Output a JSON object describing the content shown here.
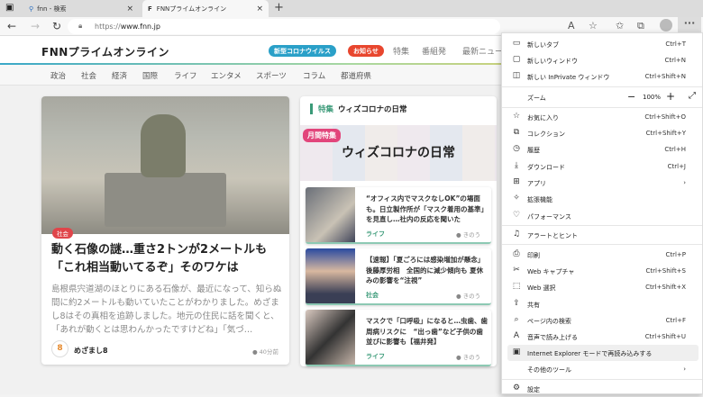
{
  "browser": {
    "tabs": [
      {
        "label": "fnn - 検索",
        "icon": "search-icon"
      },
      {
        "label": "FNNプライムオンライン",
        "icon": "fnn-favicon"
      }
    ],
    "new_tab": "+",
    "url_prefix": "https://",
    "url_domain": "www.fnn.jp"
  },
  "site": {
    "logo": "FNNプライムオンライン",
    "pills": [
      {
        "label": "新型コロナウイルス",
        "color": "#2aa0c8"
      },
      {
        "label": "お知らせ",
        "color": "#e8462e"
      }
    ],
    "header_links": [
      "特集",
      "番組発",
      "最新ニュー"
    ],
    "nav": [
      "政治",
      "社会",
      "経済",
      "国際",
      "ライフ",
      "エンタメ",
      "スポーツ",
      "コラム",
      "都道府県"
    ]
  },
  "main_article": {
    "category": "社会",
    "title": "動く石像の謎…重さ2トンが2メートルも「これ相当動いてるぞ」そのワケは",
    "description": "島根県宍道湖のほとりにある石像が、最近になって、知らぬ間に約2メートルも動いていたことがわかりました。めざまし8はその真相を追跡しました。地元の住民に話を聞くと、「あれが動くとは思わんかったですけどね」「気づ…",
    "source": "めざまし8",
    "source_icon": "8",
    "time": "40分前"
  },
  "feature": {
    "section_label": "特集",
    "section_title": "ウィズコロナの日常",
    "banner_badge": "月間特集",
    "banner_title": "ウィズコロナの日常",
    "items": [
      {
        "title": "“オフィス内でマスクなしOK”の場面も。日立製作所が「マスク着用の基準」を見直し…社内の反応を聞いた",
        "category": "ライフ",
        "time": "きのう"
      },
      {
        "title": "【速報】「夏ごろには感染増加が懸念」後藤厚労相　全国的に減少傾向も 夏休みの影響を“注視”",
        "category": "社会",
        "time": "きのう"
      },
      {
        "title": "マスクで「口呼吸」になると…虫歯、歯周病リスクに　“出っ歯”など子供の歯並びに影響も【福井発】",
        "category": "ライフ",
        "time": "きのう"
      }
    ]
  },
  "menu": {
    "items": [
      {
        "label": "新しいタブ",
        "key": "Ctrl+T",
        "icon": "new-tab-icon"
      },
      {
        "label": "新しいウィンドウ",
        "key": "Ctrl+N",
        "icon": "window-icon"
      },
      {
        "label": "新しい InPrivate ウィンドウ",
        "key": "Ctrl+Shift+N",
        "icon": "inprivate-icon"
      },
      {
        "label": "お気に入り",
        "key": "Ctrl+Shift+O",
        "icon": "favorites-icon"
      },
      {
        "label": "コレクション",
        "key": "Ctrl+Shift+Y",
        "icon": "collections-icon"
      },
      {
        "label": "履歴",
        "key": "Ctrl+H",
        "icon": "history-icon"
      },
      {
        "label": "ダウンロード",
        "key": "Ctrl+J",
        "icon": "download-icon"
      },
      {
        "label": "アプリ",
        "key": "›",
        "icon": "apps-icon"
      },
      {
        "label": "拡張機能",
        "key": "",
        "icon": "extensions-icon"
      },
      {
        "label": "パフォーマンス",
        "key": "",
        "icon": "performance-icon"
      },
      {
        "label": "アラートとヒント",
        "key": "",
        "icon": "bell-icon"
      },
      {
        "label": "印刷",
        "key": "Ctrl+P",
        "icon": "print-icon"
      },
      {
        "label": "Web キャプチャ",
        "key": "Ctrl+Shift+S",
        "icon": "capture-icon"
      },
      {
        "label": "Web 選択",
        "key": "Ctrl+Shift+X",
        "icon": "select-icon"
      },
      {
        "label": "共有",
        "key": "",
        "icon": "share-icon"
      },
      {
        "label": "ページ内の検索",
        "key": "Ctrl+F",
        "icon": "find-icon"
      },
      {
        "label": "音声で読み上げる",
        "key": "Ctrl+Shift+U",
        "icon": "read-aloud-icon"
      },
      {
        "label": "Internet Explorer モードで再読み込みする",
        "key": "",
        "icon": "ie-mode-icon"
      },
      {
        "label": "その他のツール",
        "key": "›",
        "icon": ""
      },
      {
        "label": "設定",
        "key": "",
        "icon": "settings-icon"
      }
    ],
    "zoom_label": "ズーム",
    "zoom_value": "100%"
  }
}
